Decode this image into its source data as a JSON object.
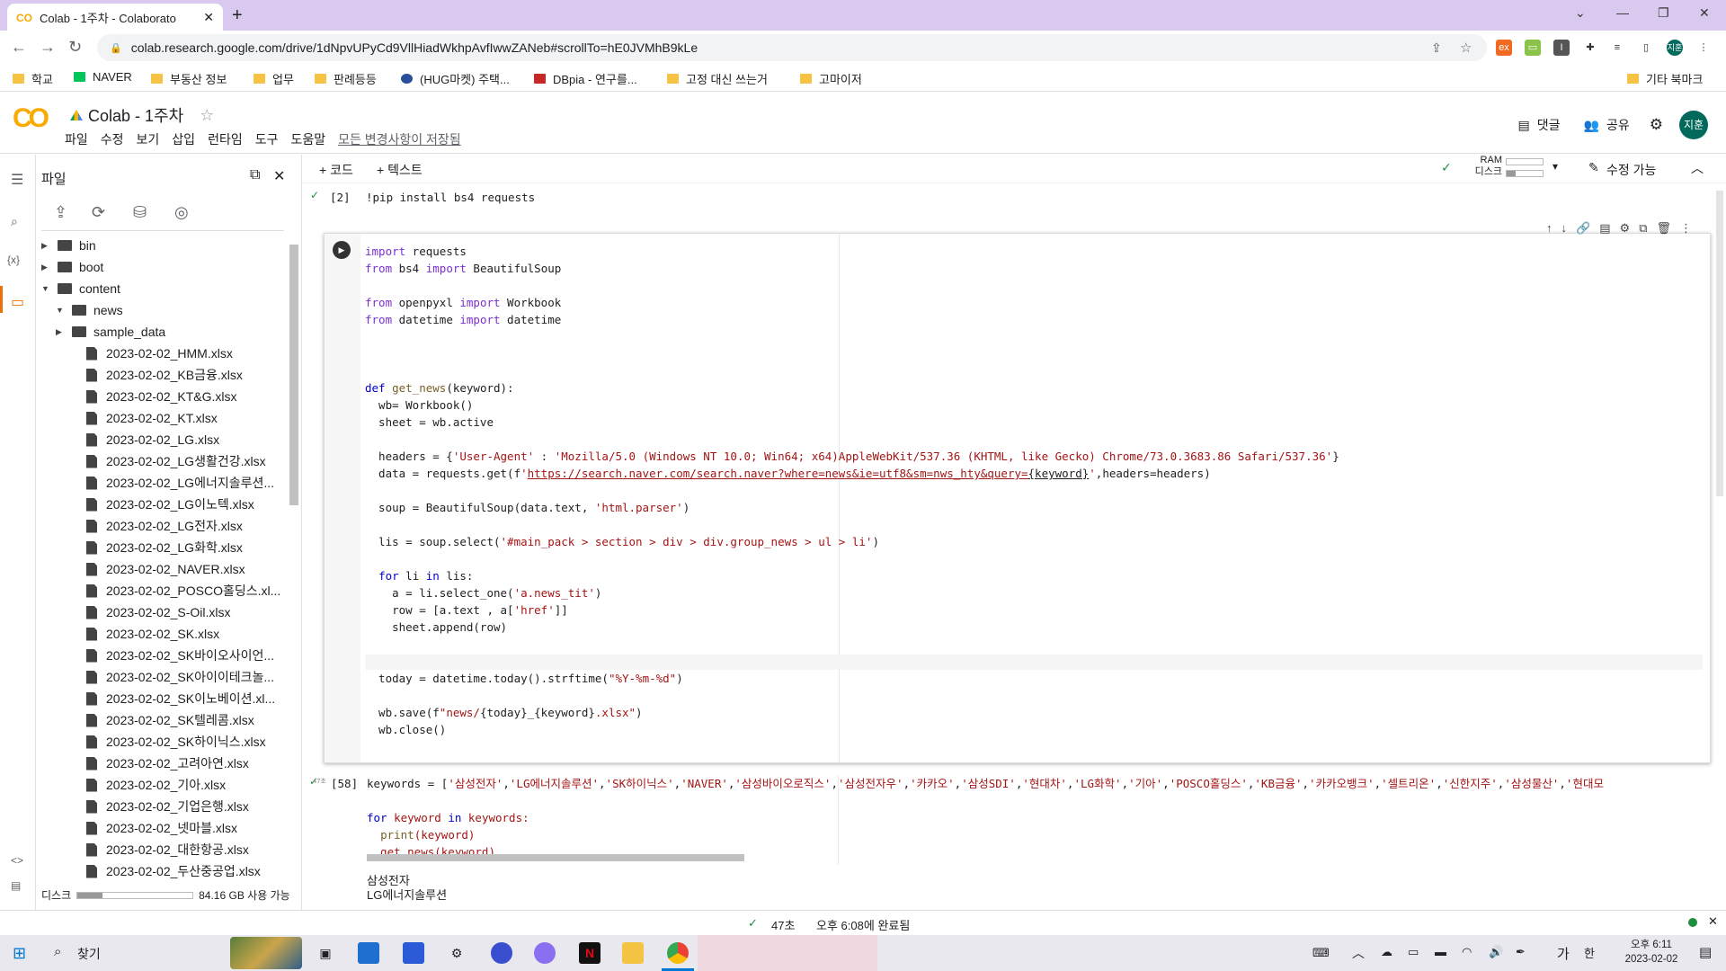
{
  "browser": {
    "tab_title": "Colab - 1주차 - Colaborato",
    "tab_favicon": "CO",
    "url": "colab.research.google.com/drive/1dNpvUPyCd9VllHiadWkhpAvfIwwZANeb#scrollTo=hE0JVMhB9kLe",
    "profile": "지훈"
  },
  "bookmarks": [
    {
      "label": "학교",
      "icon": "folder-icon"
    },
    {
      "label": "NAVER",
      "icon": "naver-icon"
    },
    {
      "label": "부동산 정보",
      "icon": "folder-icon"
    },
    {
      "label": "업무",
      "icon": "folder-icon"
    },
    {
      "label": "판례등등",
      "icon": "folder-icon"
    },
    {
      "label": "(HUG마켓) 주택...",
      "icon": "hug-icon"
    },
    {
      "label": "DBpia - 연구를...",
      "icon": "dbpia-icon"
    },
    {
      "label": "고정 대신 쓰는거",
      "icon": "folder-icon"
    },
    {
      "label": "고마이저",
      "icon": "folder-icon"
    }
  ],
  "bookmarks_other": "기타 북마크",
  "colab": {
    "title": "Colab - 1주차",
    "menu": [
      "파일",
      "수정",
      "보기",
      "삽입",
      "런타임",
      "도구",
      "도움말"
    ],
    "saved": "모든 변경사항이 저장됨",
    "comment": "댓글",
    "share": "공유",
    "avatar": "지훈",
    "add_code": "+ 코드",
    "add_text": "+ 텍스트",
    "ram": "RAM",
    "disk": "디스크",
    "edit_mode": "수정 가능"
  },
  "files_panel": {
    "title": "파일",
    "disk_label": "디스크",
    "disk_free": "84.16 GB 사용 가능",
    "tree": [
      {
        "label": "bin",
        "type": "folder",
        "depth": 0,
        "expanded": false
      },
      {
        "label": "boot",
        "type": "folder",
        "depth": 0,
        "expanded": false
      },
      {
        "label": "content",
        "type": "folder",
        "depth": 0,
        "expanded": true
      },
      {
        "label": "news",
        "type": "folder",
        "depth": 1,
        "expanded": true
      },
      {
        "label": "sample_data",
        "type": "folder",
        "depth": 1,
        "expanded": false
      },
      {
        "label": "2023-02-02_HMM.xlsx",
        "type": "file",
        "depth": 2
      },
      {
        "label": "2023-02-02_KB금융.xlsx",
        "type": "file",
        "depth": 2
      },
      {
        "label": "2023-02-02_KT&G.xlsx",
        "type": "file",
        "depth": 2
      },
      {
        "label": "2023-02-02_KT.xlsx",
        "type": "file",
        "depth": 2
      },
      {
        "label": "2023-02-02_LG.xlsx",
        "type": "file",
        "depth": 2
      },
      {
        "label": "2023-02-02_LG생활건강.xlsx",
        "type": "file",
        "depth": 2
      },
      {
        "label": "2023-02-02_LG에너지솔루션...",
        "type": "file",
        "depth": 2
      },
      {
        "label": "2023-02-02_LG이노텍.xlsx",
        "type": "file",
        "depth": 2
      },
      {
        "label": "2023-02-02_LG전자.xlsx",
        "type": "file",
        "depth": 2
      },
      {
        "label": "2023-02-02_LG화학.xlsx",
        "type": "file",
        "depth": 2
      },
      {
        "label": "2023-02-02_NAVER.xlsx",
        "type": "file",
        "depth": 2
      },
      {
        "label": "2023-02-02_POSCO홀딩스.xl...",
        "type": "file",
        "depth": 2
      },
      {
        "label": "2023-02-02_S-Oil.xlsx",
        "type": "file",
        "depth": 2
      },
      {
        "label": "2023-02-02_SK.xlsx",
        "type": "file",
        "depth": 2
      },
      {
        "label": "2023-02-02_SK바이오사이언...",
        "type": "file",
        "depth": 2
      },
      {
        "label": "2023-02-02_SK아이이테크놀...",
        "type": "file",
        "depth": 2
      },
      {
        "label": "2023-02-02_SK이노베이션.xl...",
        "type": "file",
        "depth": 2
      },
      {
        "label": "2023-02-02_SK텔레콤.xlsx",
        "type": "file",
        "depth": 2
      },
      {
        "label": "2023-02-02_SK하이닉스.xlsx",
        "type": "file",
        "depth": 2
      },
      {
        "label": "2023-02-02_고려아연.xlsx",
        "type": "file",
        "depth": 2
      },
      {
        "label": "2023-02-02_기아.xlsx",
        "type": "file",
        "depth": 2
      },
      {
        "label": "2023-02-02_기업은행.xlsx",
        "type": "file",
        "depth": 2
      },
      {
        "label": "2023-02-02_넷마블.xlsx",
        "type": "file",
        "depth": 2
      },
      {
        "label": "2023-02-02_대한항공.xlsx",
        "type": "file",
        "depth": 2
      },
      {
        "label": "2023-02-02_두산중공업.xlsx",
        "type": "file",
        "depth": 2
      }
    ]
  },
  "cells": {
    "cell1": {
      "count": "[2]",
      "code": "!pip install bs4 requests"
    },
    "cell3": {
      "count": "[58]",
      "exec_time": "47초"
    }
  },
  "output": [
    "삼성전자",
    "LG에너지솔루션"
  ],
  "status": {
    "time": "47초",
    "completed": "오후 6:08에 완료됨"
  },
  "taskbar": {
    "search": "찾기",
    "clock_time": "오후 6:11",
    "clock_date": "2023-02-02",
    "ime": "가",
    "ime2": "한"
  }
}
